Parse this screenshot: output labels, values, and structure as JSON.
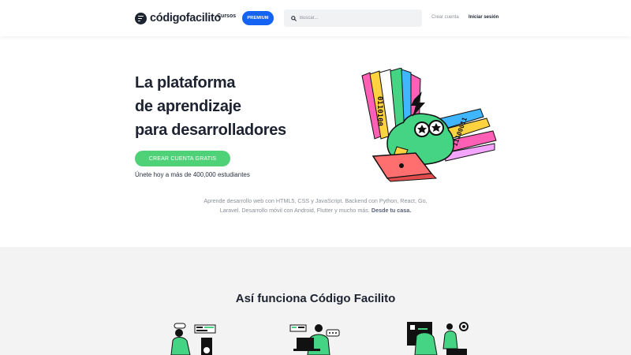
{
  "navbar": {
    "logo_text": "códigofacilito",
    "cursos_label": "Cursos",
    "premium_label": "PREMIUM",
    "search_placeholder": "Buscar...",
    "signup_label": "Crear cuenta",
    "login_label": "Iniciar sesión"
  },
  "hero": {
    "title_lines": [
      "La plataforma",
      "de aprendizaje",
      "para desarrolladores"
    ],
    "cta_label": "CREAR CUENTA GRATIS",
    "subtitle": "Únete hoy a más de 400,000 estudiantes",
    "art_text_left": "0110100",
    "art_text_right": "11100011"
  },
  "tagline": {
    "line1": "Aprende desarrollo web con HTML5, CSS y JavaScript. Backend con Python, React, Go,",
    "line2": "Laravel. Desarrollo móvil con Android, Flutter y mucho más.",
    "bold": "Desde tu casa."
  },
  "section2": {
    "title": "Así funciona Código Facilito"
  },
  "colors": {
    "brand_dark": "#1d2330",
    "premium_blue": "#1463f3",
    "cta_green": "#4fd178",
    "muted_text": "#8a8f99",
    "section_bg": "#f3f3f4"
  },
  "icons": [
    "logo-icon",
    "search-icon"
  ]
}
